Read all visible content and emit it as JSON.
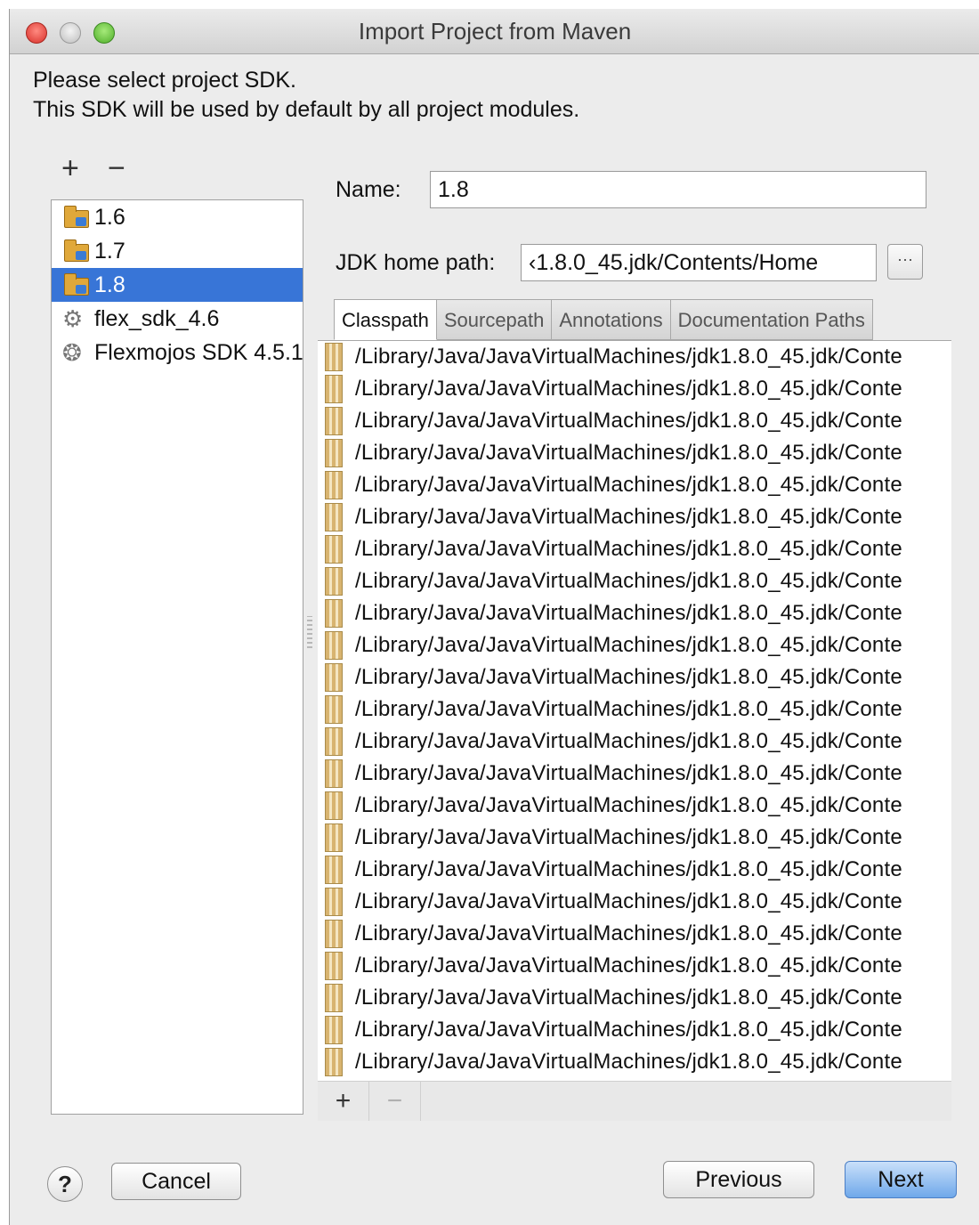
{
  "window": {
    "title": "Import Project from Maven"
  },
  "intro": {
    "line1": "Please select project SDK.",
    "line2": "This SDK will be used by default by all project modules."
  },
  "sdk_toolbar": {
    "add": "+",
    "remove": "−"
  },
  "sdk_list": {
    "items": [
      {
        "label": "1.6",
        "icon": "jdk-folder-icon"
      },
      {
        "label": "1.7",
        "icon": "jdk-folder-icon"
      },
      {
        "label": "1.8",
        "icon": "jdk-folder-icon",
        "selected": true
      },
      {
        "label": "flex_sdk_4.6",
        "icon": "flex-sdk-icon"
      },
      {
        "label": "Flexmojos SDK 4.5.1",
        "icon": "flexmojos-sdk-icon"
      }
    ]
  },
  "name_field": {
    "label": "Name:",
    "value": "1.8"
  },
  "jdk_home": {
    "label": "JDK home path:",
    "value": "‹1.8.0_45.jdk/Contents/Home",
    "browse_label": "···"
  },
  "tabs": [
    {
      "label": "Classpath",
      "active": true
    },
    {
      "label": "Sourcepath"
    },
    {
      "label": "Annotations"
    },
    {
      "label": "Documentation Paths"
    }
  ],
  "classpath": {
    "entries": [
      "/Library/Java/JavaVirtualMachines/jdk1.8.0_45.jdk/Conte",
      "/Library/Java/JavaVirtualMachines/jdk1.8.0_45.jdk/Conte",
      "/Library/Java/JavaVirtualMachines/jdk1.8.0_45.jdk/Conte",
      "/Library/Java/JavaVirtualMachines/jdk1.8.0_45.jdk/Conte",
      "/Library/Java/JavaVirtualMachines/jdk1.8.0_45.jdk/Conte",
      "/Library/Java/JavaVirtualMachines/jdk1.8.0_45.jdk/Conte",
      "/Library/Java/JavaVirtualMachines/jdk1.8.0_45.jdk/Conte",
      "/Library/Java/JavaVirtualMachines/jdk1.8.0_45.jdk/Conte",
      "/Library/Java/JavaVirtualMachines/jdk1.8.0_45.jdk/Conte",
      "/Library/Java/JavaVirtualMachines/jdk1.8.0_45.jdk/Conte",
      "/Library/Java/JavaVirtualMachines/jdk1.8.0_45.jdk/Conte",
      "/Library/Java/JavaVirtualMachines/jdk1.8.0_45.jdk/Conte",
      "/Library/Java/JavaVirtualMachines/jdk1.8.0_45.jdk/Conte",
      "/Library/Java/JavaVirtualMachines/jdk1.8.0_45.jdk/Conte",
      "/Library/Java/JavaVirtualMachines/jdk1.8.0_45.jdk/Conte",
      "/Library/Java/JavaVirtualMachines/jdk1.8.0_45.jdk/Conte",
      "/Library/Java/JavaVirtualMachines/jdk1.8.0_45.jdk/Conte",
      "/Library/Java/JavaVirtualMachines/jdk1.8.0_45.jdk/Conte",
      "/Library/Java/JavaVirtualMachines/jdk1.8.0_45.jdk/Conte",
      "/Library/Java/JavaVirtualMachines/jdk1.8.0_45.jdk/Conte",
      "/Library/Java/JavaVirtualMachines/jdk1.8.0_45.jdk/Conte",
      "/Library/Java/JavaVirtualMachines/jdk1.8.0_45.jdk/Conte",
      "/Library/Java/JavaVirtualMachines/jdk1.8.0_45.jdk/Conte"
    ],
    "add": "+",
    "remove": "−"
  },
  "footer": {
    "help": "?",
    "cancel": "Cancel",
    "previous": "Previous",
    "next": "Next"
  }
}
